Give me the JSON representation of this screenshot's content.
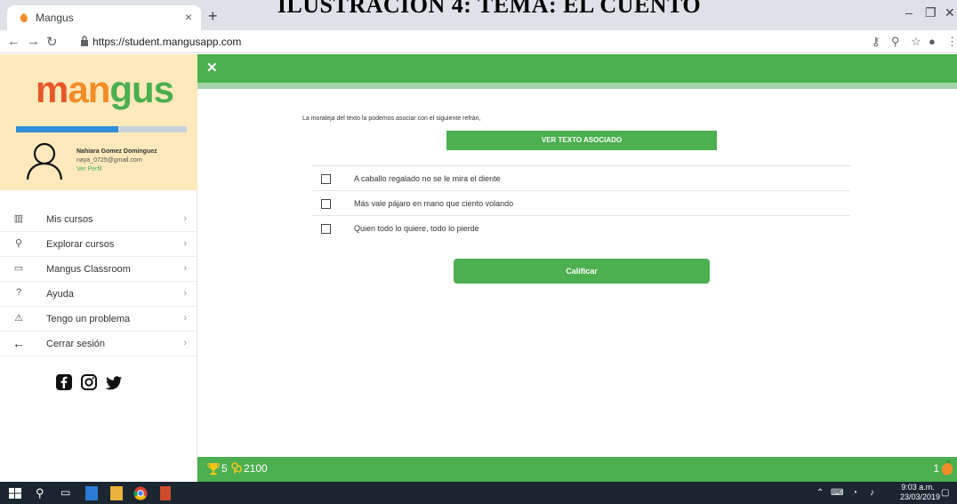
{
  "document": {
    "heading": "ILUSTRACIÓN 4: TEMA: EL CUENTO"
  },
  "browser": {
    "tab_title": "Mangus",
    "url": "https://student.mangusapp.com",
    "close_glyph": "×",
    "new_tab_glyph": "+"
  },
  "sidebar": {
    "logo": {
      "part1": "m",
      "part2": "an",
      "part3": "gus"
    },
    "progress_fraction": 0.6,
    "user": {
      "name": "Nahiara Gomez Dominguez",
      "email": "naya_0725@gmail.com",
      "profile_link": "Ver Perfil"
    },
    "menu": [
      {
        "label": "Mis cursos",
        "icon": "map-icon"
      },
      {
        "label": "Explorar cursos",
        "icon": "search-icon"
      },
      {
        "label": "Mangus Classroom",
        "icon": "classroom-icon"
      },
      {
        "label": "Ayuda",
        "icon": "help-icon"
      },
      {
        "label": "Tengo un problema",
        "icon": "warning-icon"
      },
      {
        "label": "Cerrar sesión",
        "icon": "logout-icon"
      }
    ]
  },
  "quiz": {
    "question": "La moraleja del texto la podemos asociar con el siguiente refrán,",
    "view_text_button": "VER TEXTO ASOCIADO",
    "options": [
      "A caballo regalado no se le mira el diente",
      "Más vale pájaro en mano que ciento volando",
      "Quien todo lo quiere, todo lo pierde"
    ],
    "submit_button": "Calificar"
  },
  "stats": {
    "trophies": "5",
    "points": "2100",
    "lives": "1"
  },
  "taskbar": {
    "time": "9:03 a.m.",
    "date": "23/03/2019"
  },
  "colors": {
    "brand_green": "#4caf50",
    "profile_bg": "#fde9bb",
    "progress_blue": "#2f8fd8"
  }
}
